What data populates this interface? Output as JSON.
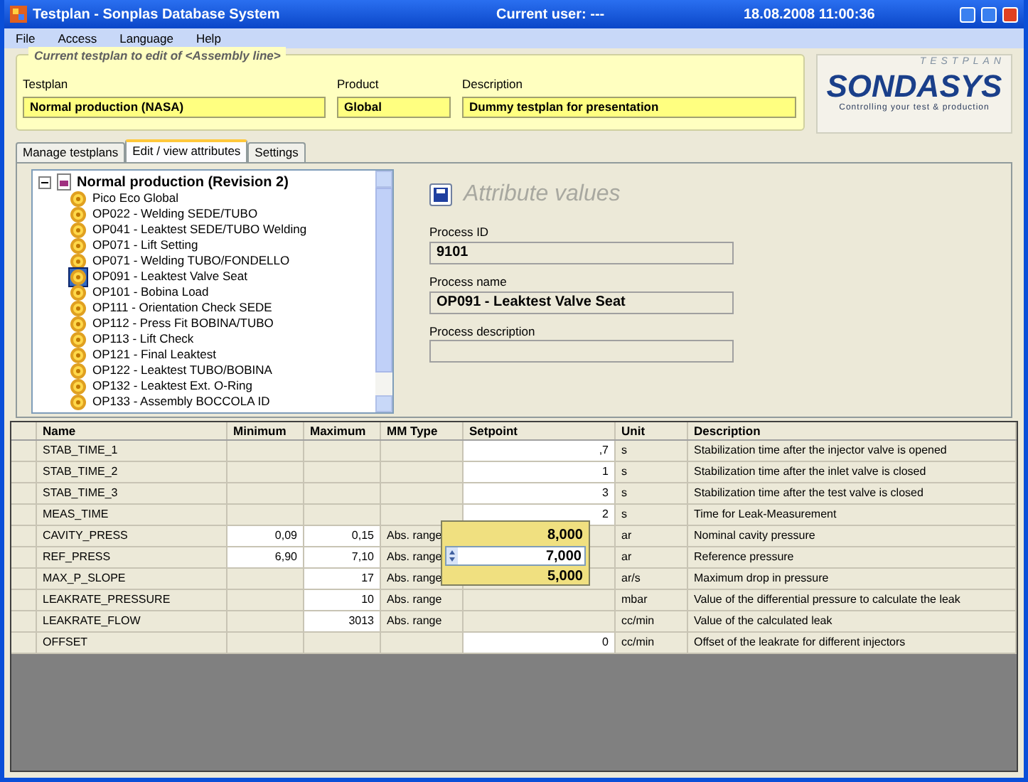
{
  "window": {
    "title": "Testplan - Sonplas Database System",
    "current_user": "Current user: ---",
    "datetime": "18.08.2008 11:00:36"
  },
  "menu": [
    "File",
    "Access",
    "Language",
    "Help"
  ],
  "header_group": {
    "legend": "Current testplan to edit of <Assembly line>",
    "fields": [
      {
        "label": "Testplan",
        "value": "Normal production (NASA)"
      },
      {
        "label": "Product",
        "value": "Global"
      },
      {
        "label": "Description",
        "value": "Dummy testplan for presentation"
      }
    ]
  },
  "logo": {
    "top": "TESTPLAN",
    "name": "SONDASYS",
    "tagline": "Controlling your test & production"
  },
  "tabs": [
    {
      "label": "Manage testplans",
      "selected": false
    },
    {
      "label": "Edit / view attributes",
      "selected": true
    },
    {
      "label": "Settings",
      "selected": false
    }
  ],
  "tree": {
    "label": "Normal production (Revision 2)",
    "expanded": true,
    "children": [
      {
        "label": "Pico Eco Global",
        "selected": false
      },
      {
        "label": "OP022 - Welding SEDE/TUBO",
        "selected": false
      },
      {
        "label": "OP041 - Leaktest SEDE/TUBO Welding",
        "selected": false
      },
      {
        "label": "OP071 - Lift Setting",
        "selected": false
      },
      {
        "label": "OP071 - Welding TUBO/FONDELLO",
        "selected": false
      },
      {
        "label": "OP091 - Leaktest Valve Seat",
        "selected": true
      },
      {
        "label": "OP101 - Bobina Load",
        "selected": false
      },
      {
        "label": "OP111 - Orientation Check SEDE",
        "selected": false
      },
      {
        "label": "OP112 - Press Fit BOBINA/TUBO",
        "selected": false
      },
      {
        "label": "OP113 - Lift Check",
        "selected": false
      },
      {
        "label": "OP121 - Final Leaktest",
        "selected": false
      },
      {
        "label": "OP122 - Leaktest TUBO/BOBINA",
        "selected": false
      },
      {
        "label": "OP132 - Leaktest Ext. O-Ring",
        "selected": false
      },
      {
        "label": "OP133 - Assembly BOCCOLA ID",
        "selected": false
      }
    ]
  },
  "attributes": {
    "title": "Attribute values",
    "fields": [
      {
        "label": "Process ID",
        "value": "9101"
      },
      {
        "label": "Process name",
        "value": "OP091 - Leaktest Valve Seat"
      },
      {
        "label": "Process description"
      }
    ]
  },
  "table": {
    "columns": [
      "Name",
      "Minimum",
      "Maximum",
      "MM Type",
      "Setpoint",
      "Unit",
      "Description"
    ],
    "rows": [
      {
        "name": "STAB_TIME_1",
        "setpoint": ",7",
        "unit": "s",
        "description": "Stabilization time after the injector valve is opened",
        "min_editable": false,
        "max_editable": false,
        "setpoint_editable": true
      },
      {
        "name": "STAB_TIME_2",
        "setpoint": "1",
        "unit": "s",
        "description": "Stabilization time after the inlet valve is closed",
        "min_editable": false,
        "max_editable": false,
        "setpoint_editable": true
      },
      {
        "name": "STAB_TIME_3",
        "setpoint": "3",
        "unit": "s",
        "description": "Stabilization time after the test valve is closed",
        "min_editable": false,
        "max_editable": false,
        "setpoint_editable": true
      },
      {
        "name": "MEAS_TIME",
        "setpoint": "2",
        "unit": "s",
        "description": "Time for Leak-Measurement",
        "min_editable": false,
        "max_editable": false,
        "setpoint_editable": true
      },
      {
        "name": "CAVITY_PRESS",
        "minimum": "0,09",
        "maximum": "0,15",
        "mm_type": "Abs. range",
        "unit": "ar",
        "description": "Nominal cavity pressure",
        "min_editable": true,
        "max_editable": true,
        "setpoint_editable": false
      },
      {
        "name": "REF_PRESS",
        "minimum": "6,90",
        "maximum": "7,10",
        "mm_type": "Abs. range",
        "unit": "ar",
        "description": "Reference pressure",
        "min_editable": true,
        "max_editable": true,
        "setpoint_editable": false
      },
      {
        "name": "MAX_P_SLOPE",
        "maximum": "17",
        "mm_type": "Abs. range",
        "unit": "ar/s",
        "description": "Maximum drop in pressure",
        "min_editable": false,
        "max_editable": true,
        "setpoint_editable": false
      },
      {
        "name": "LEAKRATE_PRESSURE",
        "maximum": "10",
        "mm_type": "Abs. range",
        "unit": "mbar",
        "description": "Value of the differential pressure to calculate the leak",
        "min_editable": false,
        "max_editable": true,
        "setpoint_editable": false
      },
      {
        "name": "LEAKRATE_FLOW",
        "maximum": "3013",
        "mm_type": "Abs. range",
        "unit": "cc/min",
        "description": "Value of the calculated leak",
        "min_editable": false,
        "max_editable": true,
        "setpoint_editable": false
      },
      {
        "name": "OFFSET",
        "setpoint": "0",
        "unit": "cc/min",
        "description": "Offset of the leakrate for different injectors",
        "min_editable": false,
        "max_editable": false,
        "setpoint_editable": true
      }
    ]
  },
  "editor_popup": {
    "maximum": "8,000",
    "value": "7,000",
    "minimum": "5,000"
  }
}
